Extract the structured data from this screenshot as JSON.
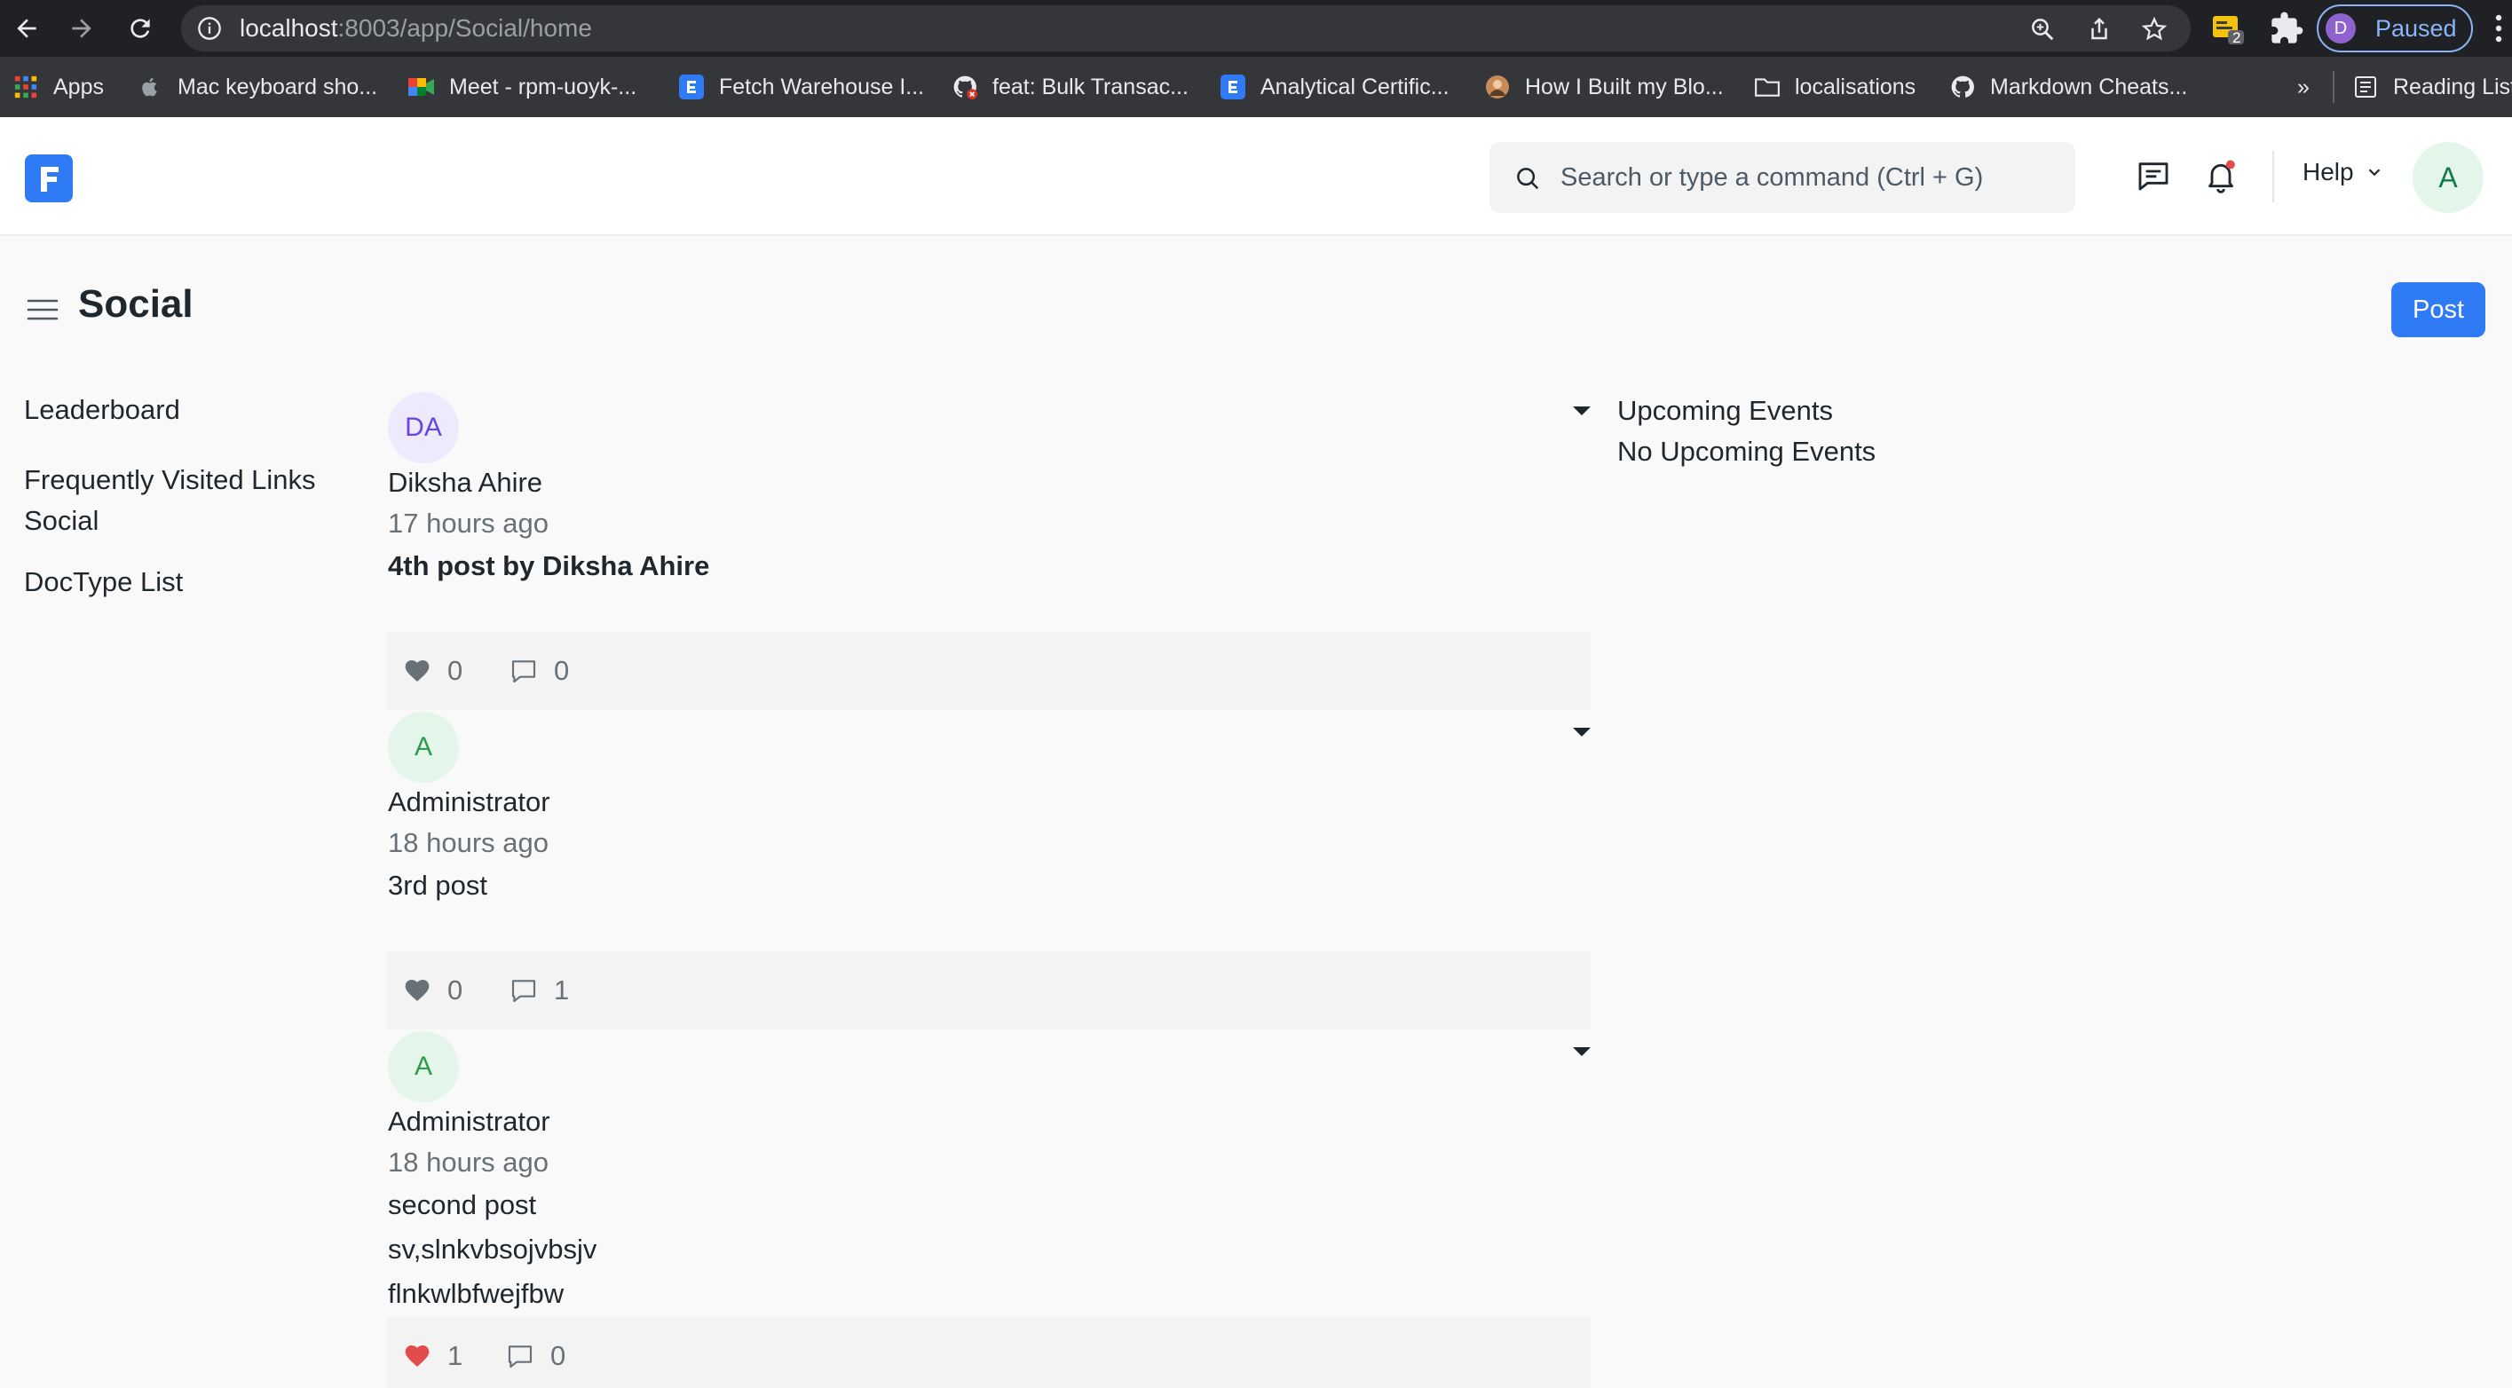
{
  "browser": {
    "url_host": "localhost",
    "url_rest": ":8003/app/Social/home",
    "extension_badge": "2",
    "profile_initial": "D",
    "profile_status": "Paused",
    "bookmarks": [
      {
        "label": "Apps",
        "icon": "apps-grid-icon"
      },
      {
        "label": "Mac keyboard sho...",
        "icon": "apple-icon"
      },
      {
        "label": "Meet - rpm-uoyk-...",
        "icon": "meet-icon"
      },
      {
        "label": "Fetch Warehouse I...",
        "icon": "frappe-e-icon"
      },
      {
        "label": "feat: Bulk Transac...",
        "icon": "github-icon"
      },
      {
        "label": "Analytical Certific...",
        "icon": "frappe-e-icon"
      },
      {
        "label": "How I Built my Blo...",
        "icon": "avatar-icon"
      },
      {
        "label": "localisations",
        "icon": "folder-icon"
      },
      {
        "label": "Markdown Cheats...",
        "icon": "github-icon"
      }
    ],
    "overflow_label": "»",
    "reading_list": "Reading List"
  },
  "navbar": {
    "logo_letter": "F",
    "search_placeholder": "Search or type a command (Ctrl + G)",
    "help_label": "Help",
    "user_initial": "A"
  },
  "page": {
    "title": "Social",
    "post_button": "Post"
  },
  "sidebar": {
    "items": [
      "Leaderboard",
      "Frequently Visited Links",
      "Social",
      "DocType List"
    ]
  },
  "posts": [
    {
      "initials": "DA",
      "author": "Diksha Ahire",
      "time": "17 hours ago",
      "lines": [
        "4th post by Diksha Ahire"
      ],
      "likes": "0",
      "comments": "0",
      "liked": false
    },
    {
      "initials": "A",
      "author": "Administrator",
      "time": "18 hours ago",
      "lines": [
        "3rd post"
      ],
      "likes": "0",
      "comments": "1",
      "liked": false
    },
    {
      "initials": "A",
      "author": "Administrator",
      "time": "18 hours ago",
      "lines": [
        "second post",
        "sv,slnkvbsojvbsjv",
        "flnkwlbfwejfbw"
      ],
      "likes": "1",
      "comments": "0",
      "liked": true
    }
  ],
  "events": {
    "title": "Upcoming Events",
    "empty": "No Upcoming Events"
  },
  "colors": {
    "primary": "#2f7bf5",
    "like_active": "#e24c4c",
    "like_inactive": "#687178"
  }
}
